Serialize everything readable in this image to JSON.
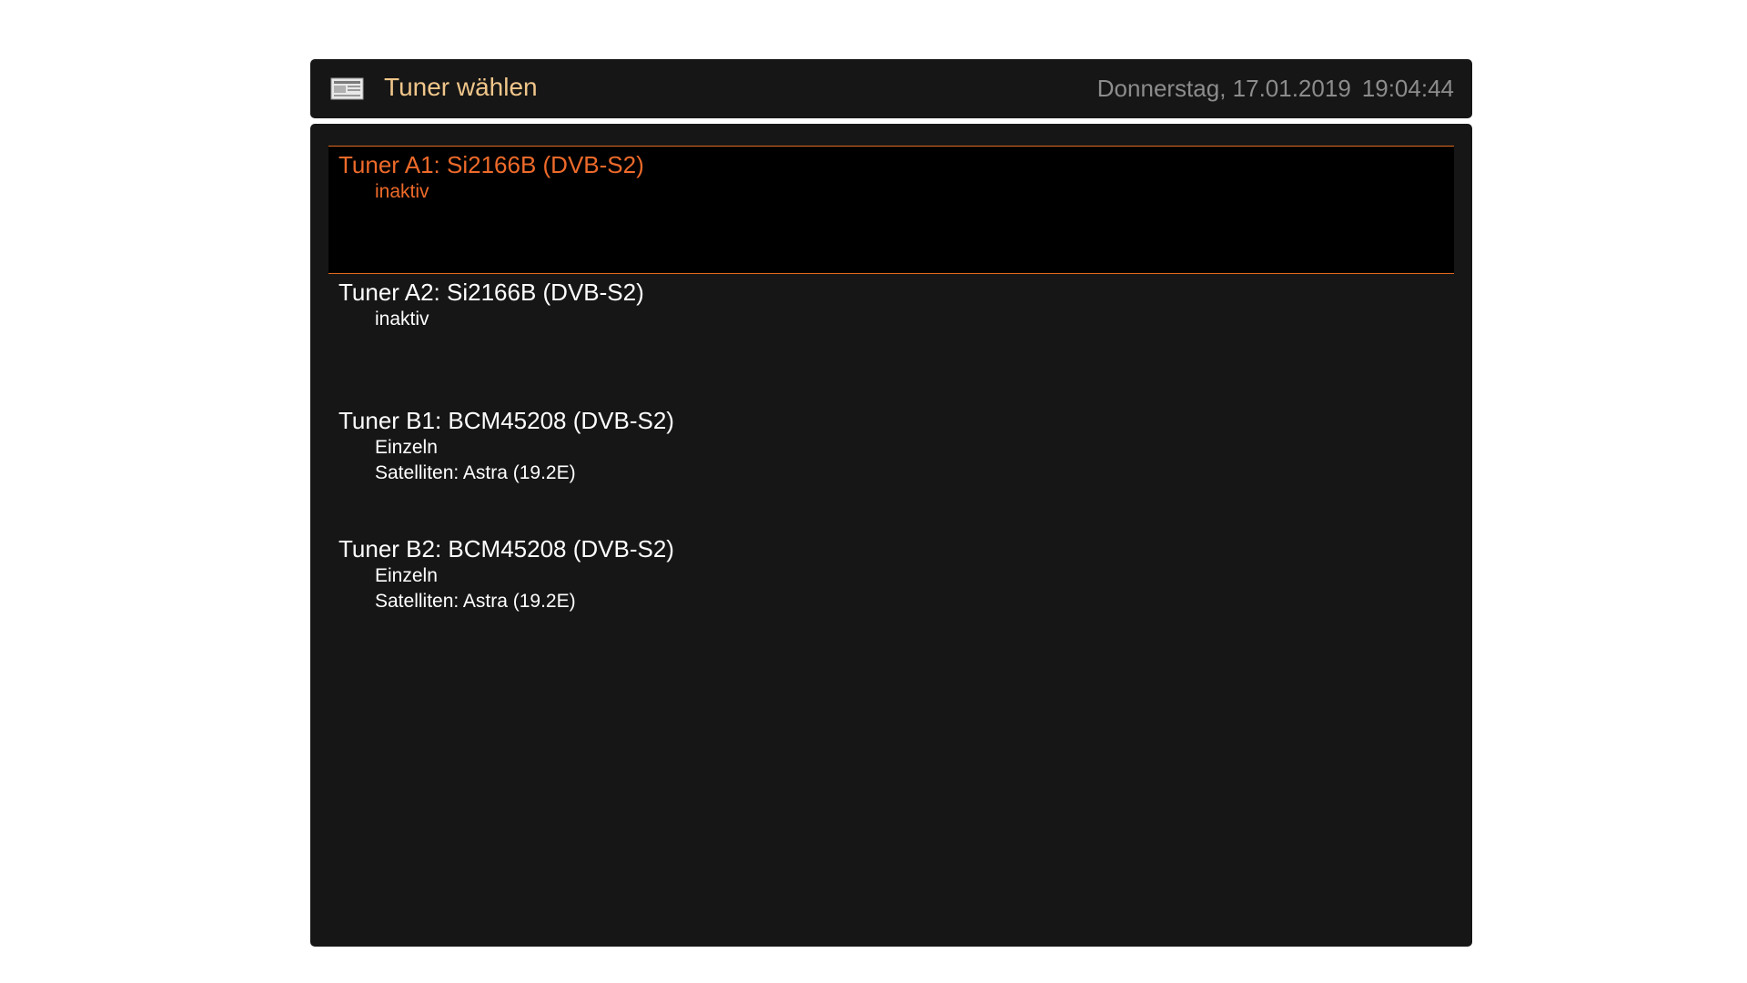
{
  "header": {
    "icon": "document-icon",
    "title": "Tuner wählen",
    "date": "Donnerstag, 17.01.2019",
    "time": "19:04:44"
  },
  "colors": {
    "accent": "#ee6a2a",
    "title": "#f0c68a",
    "clock": "#8c8c8c",
    "panel": "#161616"
  },
  "tuners": [
    {
      "title": "Tuner A1: Si2166B (DVB-S2)",
      "lines": [
        "inaktiv"
      ],
      "selected": true
    },
    {
      "title": "Tuner A2: Si2166B (DVB-S2)",
      "lines": [
        "inaktiv"
      ],
      "selected": false
    },
    {
      "title": "Tuner B1: BCM45208 (DVB-S2)",
      "lines": [
        "Einzeln",
        "Satelliten: Astra (19.2E)"
      ],
      "selected": false
    },
    {
      "title": "Tuner B2: BCM45208 (DVB-S2)",
      "lines": [
        "Einzeln",
        "Satelliten: Astra (19.2E)"
      ],
      "selected": false
    }
  ]
}
